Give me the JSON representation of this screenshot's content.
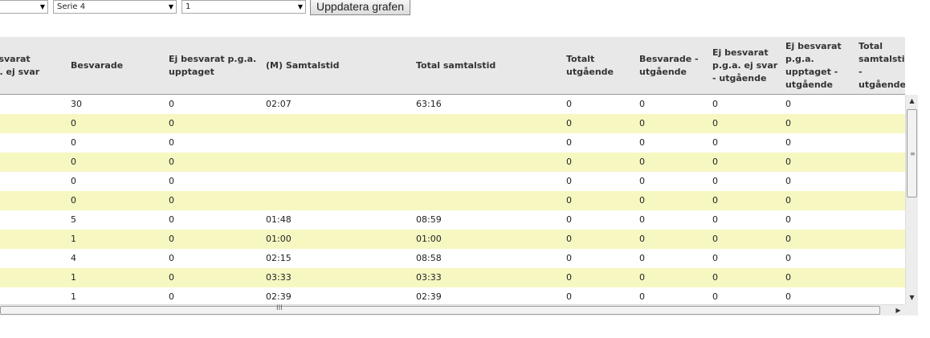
{
  "controls": {
    "select1": "",
    "select2": "Serie 4",
    "select3": "1",
    "update_button": "Uppdatera grafen"
  },
  "table": {
    "headers": [
      "Ej besvarat p.g.a. ej svar",
      "Besvarade",
      "Ej besvarat p.g.a. upptaget",
      "(M) Samtalstid",
      "Total samtalstid",
      "Totalt utgående",
      "Besvarade - utgående",
      "Ej besvarat p.g.a. ej svar - utgående",
      "Ej besvarat p.g.a. upptaget - utgående",
      "Total samtalstid - utgående"
    ],
    "rows": [
      [
        "",
        "30",
        "0",
        "02:07",
        "63:16",
        "0",
        "0",
        "0",
        "0",
        ""
      ],
      [
        "",
        "0",
        "0",
        "",
        "",
        "0",
        "0",
        "0",
        "0",
        ""
      ],
      [
        "",
        "0",
        "0",
        "",
        "",
        "0",
        "0",
        "0",
        "0",
        ""
      ],
      [
        "",
        "0",
        "0",
        "",
        "",
        "0",
        "0",
        "0",
        "0",
        ""
      ],
      [
        "",
        "0",
        "0",
        "",
        "",
        "0",
        "0",
        "0",
        "0",
        ""
      ],
      [
        "",
        "0",
        "0",
        "",
        "",
        "0",
        "0",
        "0",
        "0",
        ""
      ],
      [
        "",
        "5",
        "0",
        "01:48",
        "08:59",
        "0",
        "0",
        "0",
        "0",
        ""
      ],
      [
        "",
        "1",
        "0",
        "01:00",
        "01:00",
        "0",
        "0",
        "0",
        "0",
        ""
      ],
      [
        "",
        "4",
        "0",
        "02:15",
        "08:58",
        "0",
        "0",
        "0",
        "0",
        ""
      ],
      [
        "",
        "1",
        "0",
        "03:33",
        "03:33",
        "0",
        "0",
        "0",
        "0",
        ""
      ],
      [
        "",
        "1",
        "0",
        "02:39",
        "02:39",
        "0",
        "0",
        "0",
        "0",
        ""
      ]
    ]
  },
  "icons": {
    "dropdown": "chevron-down-icon",
    "scroll_up": "arrow-up-icon",
    "scroll_down": "arrow-down-icon",
    "scroll_right": "arrow-right-icon"
  },
  "colors": {
    "header_bg": "#e8e8e8",
    "alt_row_bg": "#f7f7c2"
  }
}
